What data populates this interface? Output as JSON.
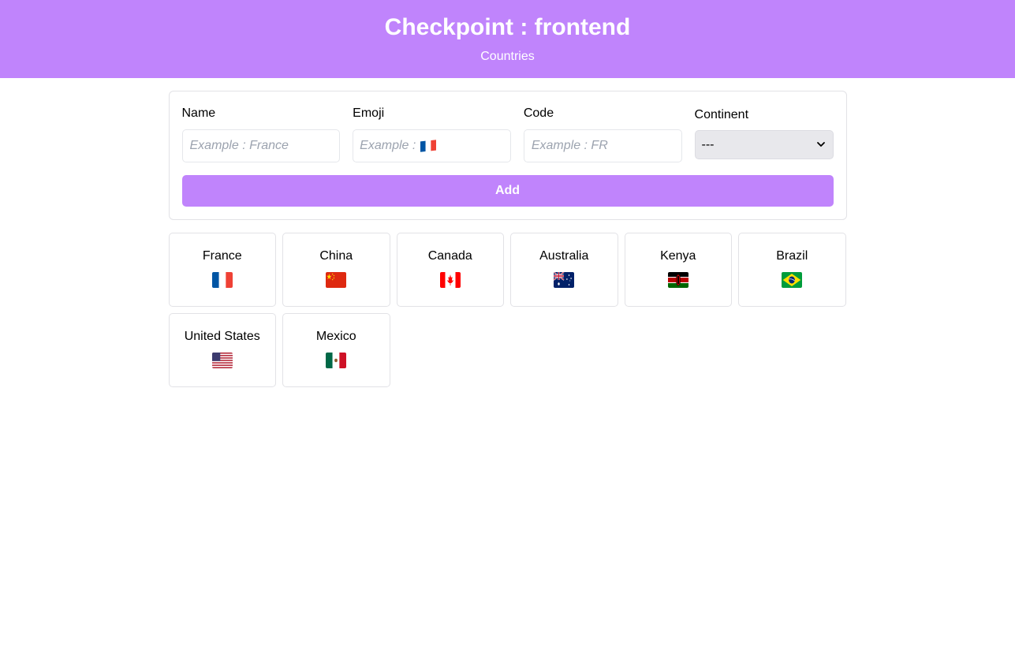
{
  "header": {
    "title": "Checkpoint : frontend",
    "subtitle": "Countries"
  },
  "form": {
    "name": {
      "label": "Name",
      "placeholder": "Example : France"
    },
    "emoji": {
      "label": "Emoji",
      "placeholder_text": "Example :",
      "placeholder_flag": "flag-france-icon"
    },
    "code": {
      "label": "Code",
      "placeholder": "Example : FR"
    },
    "continent": {
      "label": "Continent",
      "selected": "---"
    },
    "add_label": "Add"
  },
  "countries": [
    {
      "name": "France",
      "flag": "flag-france-icon"
    },
    {
      "name": "China",
      "flag": "flag-china-icon"
    },
    {
      "name": "Canada",
      "flag": "flag-canada-icon"
    },
    {
      "name": "Australia",
      "flag": "flag-australia-icon"
    },
    {
      "name": "Kenya",
      "flag": "flag-kenya-icon"
    },
    {
      "name": "Brazil",
      "flag": "flag-brazil-icon"
    },
    {
      "name": "United States",
      "flag": "flag-united-states-icon"
    },
    {
      "name": "Mexico",
      "flag": "flag-mexico-icon"
    }
  ],
  "colors": {
    "accent": "#c084fc",
    "border": "#e2e2e6",
    "placeholder": "#9ca3af"
  }
}
